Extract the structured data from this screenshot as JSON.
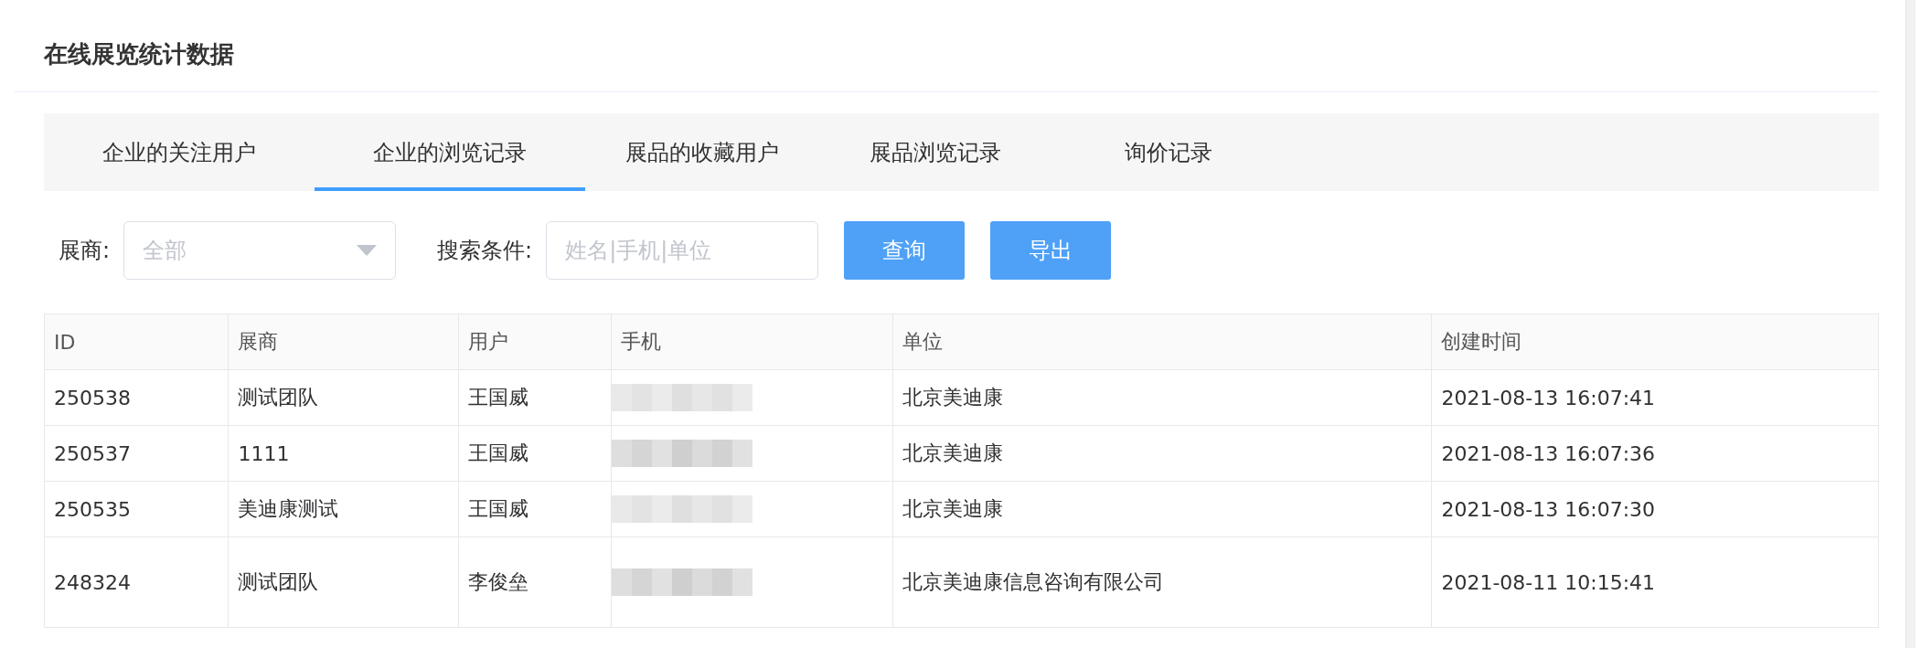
{
  "page_title": "在线展览统计数据",
  "tabs": [
    {
      "label": "企业的关注用户",
      "selected": false
    },
    {
      "label": "企业的浏览记录",
      "selected": true
    },
    {
      "label": "展品的收藏用户",
      "selected": false
    },
    {
      "label": "展品浏览记录",
      "selected": false
    },
    {
      "label": "询价记录",
      "selected": false
    }
  ],
  "filters": {
    "exhibitor_label": "展商:",
    "exhibitor_value": "全部",
    "search_label": "搜索条件:",
    "search_placeholder": "姓名|手机|单位"
  },
  "buttons": [
    "查询",
    "导出"
  ],
  "table": {
    "columns": [
      "ID",
      "展商",
      "用户",
      "手机",
      "单位",
      "创建时间"
    ],
    "rows": [
      {
        "id": "250538",
        "exhibitor": "测试团队",
        "user": "王国威",
        "unit": "北京美迪康",
        "created": "2021-08-13 16:07:41"
      },
      {
        "id": "250537",
        "exhibitor": "1111",
        "user": "王国威",
        "unit": "北京美迪康",
        "created": "2021-08-13 16:07:36"
      },
      {
        "id": "250535",
        "exhibitor": "美迪康测试",
        "user": "王国威",
        "unit": "北京美迪康",
        "created": "2021-08-13 16:07:30"
      },
      {
        "id": "248324",
        "exhibitor": "测试团队",
        "user": "李俊垒",
        "unit": "北京美迪康信息咨询有限公司",
        "created": "2021-08-11 10:15:41"
      }
    ]
  }
}
